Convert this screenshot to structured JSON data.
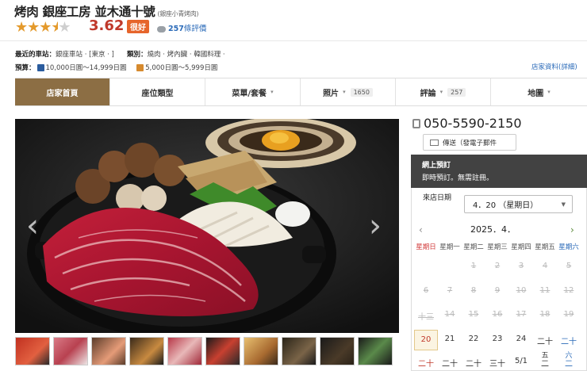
{
  "header": {
    "title": "烤肉 銀座工房 並木通十號",
    "subtitle": "(銀座小青烤肉)",
    "stars": "★★★",
    "star_half": "★",
    "stars_empty": "★",
    "score": "3.62",
    "badge": "很好",
    "review_count": "257",
    "review_suffix": "條評價"
  },
  "info": {
    "station_label": "最近的車站：",
    "station_value": "銀座車站 · [東京 · ]",
    "category_label": "類別：",
    "category_value": "燒肉 · 烤內臟 · 韓國料理 ·",
    "budget_label": "預算：",
    "dinner_value": "10,000日圓～14,999日圓",
    "lunch_value": "5,000日圓～5,999日圓",
    "shop_info_link": "店家資料(詳細)"
  },
  "nav": {
    "tabs": [
      {
        "label": "店家首頁",
        "count": ""
      },
      {
        "label": "座位類型",
        "count": ""
      },
      {
        "label": "菜單/套餐",
        "count": ""
      },
      {
        "label": "照片",
        "count": "1650"
      },
      {
        "label": "評論",
        "count": "257"
      },
      {
        "label": "地圖",
        "count": ""
      }
    ]
  },
  "contact": {
    "phone": "050-5590-2150",
    "send_label": "傳送（發電子郵件"
  },
  "reservation": {
    "header": "網上預訂",
    "subtitle": "即時預訂。無需註冊。",
    "date_label": "來店日期",
    "date_value": "4．20 （星期日）",
    "month_label": "2025．4．",
    "weekdays": [
      "星期日",
      "星期一",
      "星期二",
      "星期三",
      "星期四",
      "星期五",
      "星期六"
    ],
    "rows": [
      [
        "",
        "",
        "1",
        "2",
        "3",
        "4",
        "5"
      ],
      [
        "6",
        "7",
        "8",
        "9",
        "10",
        "11",
        "12"
      ],
      [
        "十三",
        "14",
        "15",
        "16",
        "17",
        "18",
        "19"
      ],
      [
        "20",
        "21",
        "22",
        "23",
        "24",
        "二十",
        "二十"
      ],
      [
        "二十",
        "二十",
        "二十",
        "三十",
        "5/1",
        "二",
        "二"
      ]
    ],
    "last_row_extra": [
      "",
      "",
      "",
      "",
      "",
      "五",
      "六"
    ]
  },
  "colors": {
    "accent": "#8c6e44",
    "star": "#e49a2c",
    "score": "#c0392b",
    "link": "#2a6ab8",
    "badge": "#e6652b",
    "reserve_header": "#424242"
  }
}
